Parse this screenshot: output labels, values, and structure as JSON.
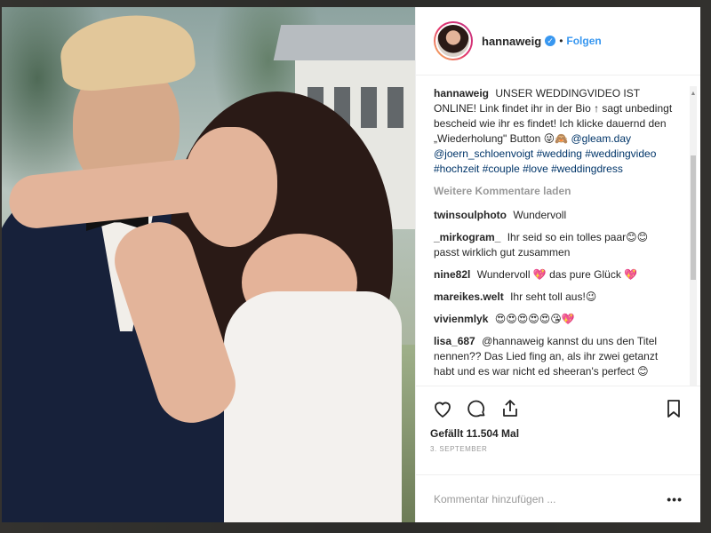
{
  "post": {
    "username": "hannaweig",
    "verified_icon": "verified-badge-icon",
    "separator": "•",
    "follow_label": "Folgen",
    "caption": {
      "username": "hannaweig",
      "text": "UNSER WEDDINGVIDEO IST ONLINE! Link findet ihr in der Bio ↑ sagt unbedingt bescheid wie ihr es findet! Ich klicke dauernd den „Wiederholung\" Button 😜🙈",
      "mention1": "@gleam.day",
      "mention2": "@joern_schloenvoigt",
      "hashtags": "#wedding #weddingvideo #hochzeit #couple #love #weddingdress"
    },
    "load_more": "Weitere Kommentare laden",
    "comments": [
      {
        "user": "twinsoulphoto",
        "text": "Wundervoll"
      },
      {
        "user": "_mirkogram_",
        "text": "Ihr seid so ein tolles paar😊😊 passt wirklich gut zusammen"
      },
      {
        "user": "nine82l",
        "text": "Wundervoll 💖 das pure Glück 💖"
      },
      {
        "user": "mareikes.welt",
        "text": "Ihr seht toll aus!😉"
      },
      {
        "user": "vivienmlyk",
        "text": "😍😍😍😍😍😘💖"
      },
      {
        "user": "lisa_687",
        "text": "@hannaweig kannst du uns den Titel nennen?? Das Lied fing an, als ihr zwei getanzt habt und es war nicht ed sheeran's perfect 😊"
      }
    ],
    "likes": "Gefällt 11.504 Mal",
    "date": "3. SEPTEMBER",
    "comment_placeholder": "Kommentar hinzufügen ...",
    "more_label": "•••"
  },
  "colors": {
    "accent": "#3897f0",
    "link": "#003569",
    "muted": "#999999"
  }
}
